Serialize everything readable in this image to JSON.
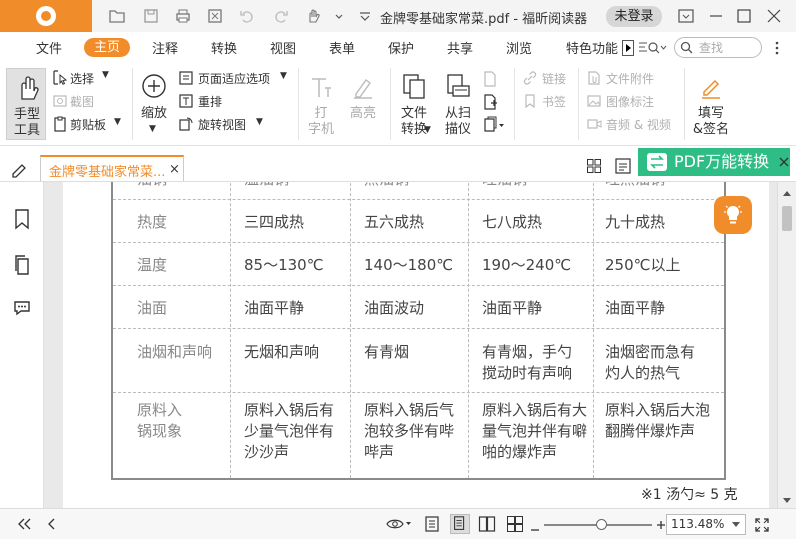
{
  "titlebar": {
    "file_title": "金牌零基础家常菜.pdf - 福昕阅读器",
    "login_label": "未登录"
  },
  "menu": {
    "tabs": [
      "文件",
      "主页",
      "注释",
      "转换",
      "视图",
      "表单",
      "保护",
      "共享",
      "浏览",
      "特色功能"
    ],
    "search_placeholder": "查找"
  },
  "ribbon": {
    "hand_tool": "手型\n工具",
    "select": "选择",
    "snapshot": "截图",
    "clipboard": "剪贴板",
    "zoom": "缩放",
    "fit_page": "页面适应选项",
    "reflow": "重排",
    "rotate_view": "旋转视图",
    "typewriter": "打\n字机",
    "highlight": "高亮",
    "file_convert": "文件\n转换",
    "from_scanner": "从扫\n描仪",
    "link": "链接",
    "bookmark": "书签",
    "file_attachment": "文件附件",
    "image_annotation": "图像标注",
    "audio_video": "音频 & 视频",
    "fill_sign": "填写\n&签名"
  },
  "doc_tab": {
    "label": "金牌零基础家常菜...",
    "close": "×"
  },
  "pdf_convert_label": "PDF万能转换",
  "document": {
    "table": {
      "rows": [
        [
          "油锅",
          "温油锅",
          "热油锅",
          "旺油锅",
          "旺热油锅"
        ],
        [
          "热度",
          "三四成热",
          "五六成热",
          "七八成热",
          "九十成热"
        ],
        [
          "温度",
          "85～130℃",
          "140～180℃",
          "190～240℃",
          "250℃以上"
        ],
        [
          "油面",
          "油面平静",
          "油面波动",
          "油面平静",
          "油面平静"
        ],
        [
          "油烟和声响",
          "无烟和声响",
          "有青烟",
          "有青烟，手勺\n搅动时有声响",
          "油烟密而急有\n灼人的热气"
        ],
        [
          "原料入\n锅现象",
          "原料入锅后有\n少量气泡伴有\n沙沙声",
          "原料入锅后气\n泡较多伴有哔\n哔声",
          "原料入锅后有大\n量气泡并伴有噼\n啪的爆炸声",
          "原料入锅后大泡\n翻腾伴爆炸声"
        ]
      ]
    },
    "footnote": "※1 汤勺≈ 5 克"
  },
  "statusbar": {
    "zoom_value": "113.48%",
    "zoom_slider_level": 0.53
  },
  "colors": {
    "accent": "#f18c2b",
    "convert_green": "#2ebd85"
  }
}
